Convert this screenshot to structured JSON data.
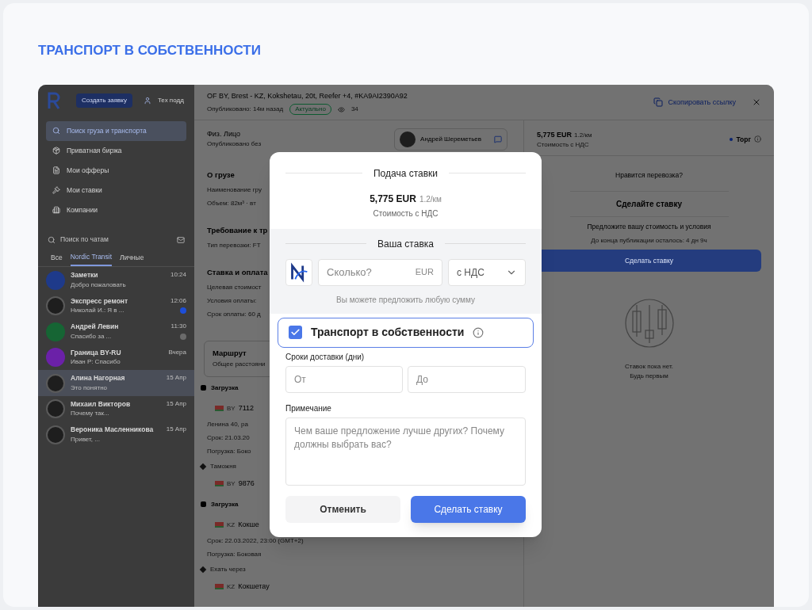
{
  "page_title": "ТРАНСПОРТ В СОБСТВЕННОСТИ",
  "sidebar": {
    "create_button": "Создать заявку",
    "support": "Тех подд",
    "nav": [
      {
        "label": "Поиск груза и транспорта",
        "selected": true
      },
      {
        "label": "Приватная биржа",
        "selected": false
      },
      {
        "label": "Мои офферы",
        "selected": false
      },
      {
        "label": "Мои ставки",
        "selected": false
      },
      {
        "label": "Компании",
        "selected": false
      }
    ],
    "search": {
      "placeholder": "Поиск по чатам"
    },
    "tabs": [
      {
        "label": "Все",
        "selected": false
      },
      {
        "label": "Nordic Transit",
        "selected": true
      },
      {
        "label": "Личные",
        "selected": false
      }
    ],
    "chats": [
      {
        "name": "Заметки",
        "preview": "Добро пожаловать",
        "time": "10:24",
        "kind": "color",
        "color": "#1e3a8a",
        "selected": false
      },
      {
        "name": "Экспресс ремонт",
        "preview": "Николай И.: Я в ...",
        "time": "12:06",
        "kind": "photo",
        "selected": false,
        "badge": {
          "color": "#1d4ed8"
        }
      },
      {
        "name": "Андрей Левин",
        "preview": "Спасибо за ...",
        "time": "11:30",
        "kind": "color",
        "color": "#166534",
        "selected": false,
        "badge": {
          "color": "#6b6b6b"
        }
      },
      {
        "name": "Граница BY-RU",
        "preview": "Иван Р: Спасибо",
        "time": "Вчера",
        "kind": "color",
        "color": "#6b21a8",
        "selected": false
      },
      {
        "name": "Алина Нагорная",
        "preview": "Это понятно",
        "time": "15 Апр",
        "kind": "photo",
        "selected": true
      },
      {
        "name": "Михаил Викторов",
        "preview": "Почему так...",
        "time": "15 Апр",
        "kind": "photo",
        "selected": false
      },
      {
        "name": "Вероника Масленникова",
        "preview": "Привет, ...",
        "time": "15 Апр",
        "kind": "photo",
        "selected": false
      }
    ]
  },
  "order": {
    "title": "OF BY, Brest - KZ, Kokshetau, 20t, Reefer +4, #KA9AI2390A92",
    "published": "Опубликовано: 14м назад",
    "status": "Актуально",
    "views": "34",
    "copy_link": "Скопировать ссылку",
    "customer": "Физ. Лицо",
    "customer_note": "Опубликовано без",
    "contact": "Андрей Шереметьев",
    "details": [
      {
        "kind": "section",
        "text": "О грузе"
      },
      {
        "kind": "line",
        "text": "Наименование гру"
      },
      {
        "kind": "line",
        "text": "Объем: 82м³ · вт"
      },
      {
        "kind": "section",
        "text": "Требование к тр"
      },
      {
        "kind": "line",
        "text": "Тип перевозки: FT"
      },
      {
        "kind": "section",
        "text": "Ставка и оплата"
      },
      {
        "kind": "line",
        "text": "Целевая стоимост"
      },
      {
        "kind": "line",
        "text": "Условия оплаты: "
      },
      {
        "kind": "line",
        "text": "Срок оплаты: 60 д"
      },
      {
        "kind": "card",
        "text": "Маршрут",
        "sub": "Общее расстояни"
      },
      {
        "kind": "stop",
        "text": "Загрузка"
      },
      {
        "kind": "place",
        "code": "BY",
        "text": "7112"
      },
      {
        "kind": "line",
        "text": "Ленина 40, ра"
      },
      {
        "kind": "line",
        "text": "Срок: 21.03.20"
      },
      {
        "kind": "line",
        "text": "Погрузка: Боко"
      },
      {
        "kind": "via",
        "text": "Таможня"
      },
      {
        "kind": "place",
        "code": "BY",
        "text": "9876"
      },
      {
        "kind": "stop",
        "text": "Загрузка"
      },
      {
        "kind": "place",
        "code": "KZ",
        "text": "Кокше"
      },
      {
        "kind": "line",
        "text": "Срок: 22.03.2022, 23:00 (GMT+2)"
      },
      {
        "kind": "line",
        "text": "Погрузка: Боковая"
      },
      {
        "kind": "via",
        "text": "Ехать через"
      },
      {
        "kind": "place",
        "code": "KZ",
        "text": "Кокшетау"
      }
    ],
    "price": "5,775 EUR",
    "per_km": "1.2/км",
    "price_note": "Стоимость с НДС",
    "haggle": "Торг",
    "prompt": "Нравится перевозка?",
    "cta_title": "Сделайте ставку",
    "cta_text": "Предложите вашу стоимость и условия",
    "time_left": "До конца публикации осталось: 4 дн 9ч",
    "bid_button": "Сделать ставку",
    "empty_1": "Ставок пока нет.",
    "empty_2": "Будь первым"
  },
  "modal": {
    "title": "Подача ставки",
    "price": "5,775 EUR",
    "per_km": "1.2/км",
    "price_note": "Стоимость с НДС",
    "your_bid": "Ваша ставка",
    "amount": {
      "placeholder": "Сколько?",
      "suffix": "EUR"
    },
    "vat": "с НДС",
    "hint": "Вы можете предложить любую сумму",
    "own_transport": {
      "label": "Транспорт в собственности",
      "checked": true
    },
    "delivery_label": "Сроки доставки (дни)",
    "from": {
      "placeholder": "От"
    },
    "to": {
      "placeholder": "До"
    },
    "note_label": "Примечание",
    "note": {
      "placeholder": "Чем ваше предложение лучше других? Почему должны выбрать вас?"
    },
    "cancel": "Отменить",
    "submit": "Сделать ставку"
  }
}
